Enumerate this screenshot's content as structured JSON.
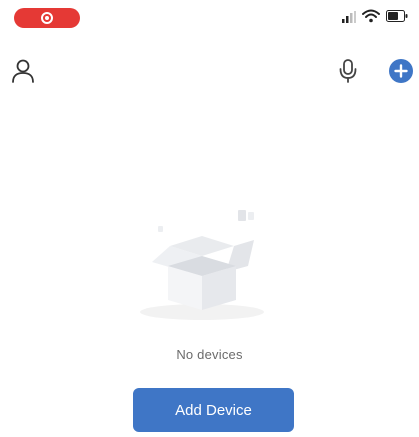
{
  "status_bar": {
    "recording_indicator": "screen-recording-icon",
    "signal": "cellular-signal-icon",
    "wifi": "wifi-icon",
    "battery": "battery-icon"
  },
  "header": {
    "left_icon": "profile-icon",
    "right_icons": [
      "microphone-icon",
      "add-circle-icon"
    ]
  },
  "empty_state": {
    "illustration": "empty-box-illustration",
    "message": "No devices"
  },
  "primary_action": {
    "label": "Add Device"
  },
  "colors": {
    "accent": "#3f76c6",
    "recording": "#e53935",
    "text_muted": "#6b6b6b"
  }
}
